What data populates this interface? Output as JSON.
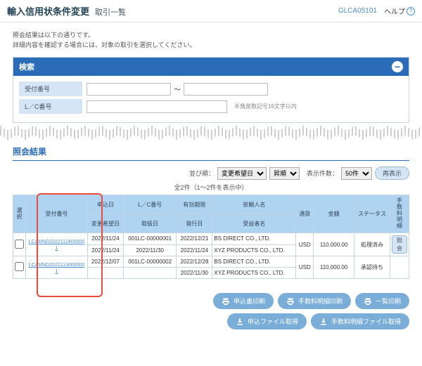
{
  "header": {
    "title": "輸入信用状条件変更",
    "subtitle": "取引一覧",
    "screenId": "GLCA05101",
    "help": "ヘルプ"
  },
  "info": {
    "line1": "照会結果は以下の通りです。",
    "line2": "詳細内容を確認する場合には、対象の取引を選択してください。"
  },
  "search": {
    "title": "検索",
    "label1": "受付番号",
    "label2": "L／C番号",
    "tilde": "～",
    "hint": "半角英数記号16文字以内"
  },
  "result": {
    "title": "照会結果",
    "sortLabel": "並び順：",
    "sort1": "変更希望日",
    "sort2": "昇順",
    "countLabel": "表示件数：",
    "countOpt": "50件",
    "redisplay": "再表示",
    "counter": "全2件（1～2件を表示中）"
  },
  "cols": {
    "sel": "選択",
    "recno": "受付番号",
    "app": "申込日",
    "chg": "変更希望日",
    "lc": "L／C番号",
    "ref": "取扱日",
    "exp": "有効期限",
    "iss": "発行日",
    "cli": "依頼人名",
    "ben": "受益者名",
    "cur": "通貨",
    "amt": "金額",
    "sts": "ステータス",
    "fee": "手数料明細"
  },
  "rows": [
    {
      "recno": "LCAMND20221124000001",
      "app": "2022/11/24",
      "chg": "2022/11/24",
      "lc": "001LC-00000001",
      "ref": "2022/11/30",
      "exp": "2022/12/21",
      "iss": "2022/11/24",
      "cli": "BS DIRECT CO., LTD.",
      "ben": "XYZ PRODUCTS CO., LTD.",
      "cur": "USD",
      "amt": "110,000.00",
      "sts": "処理済み",
      "btn": "照会"
    },
    {
      "recno": "LCAMND20221130000001",
      "app": "2022/12/07",
      "chg": "",
      "lc": "001LC-00000002",
      "ref": "",
      "exp": "2022/12/28",
      "iss": "2022/11/30",
      "cli": "BS DIRECT CO., LTD.",
      "ben": "XYZ PRODUCTS CO., LTD.",
      "cur": "USD",
      "amt": "110,000.00",
      "sts": "承認待ち",
      "btn": ""
    }
  ],
  "btns": {
    "b1": "申込書印刷",
    "b2": "手数料明細印刷",
    "b3": "一覧印刷",
    "b4": "申込ファイル取得",
    "b5": "手数料明細ファイル取得"
  }
}
